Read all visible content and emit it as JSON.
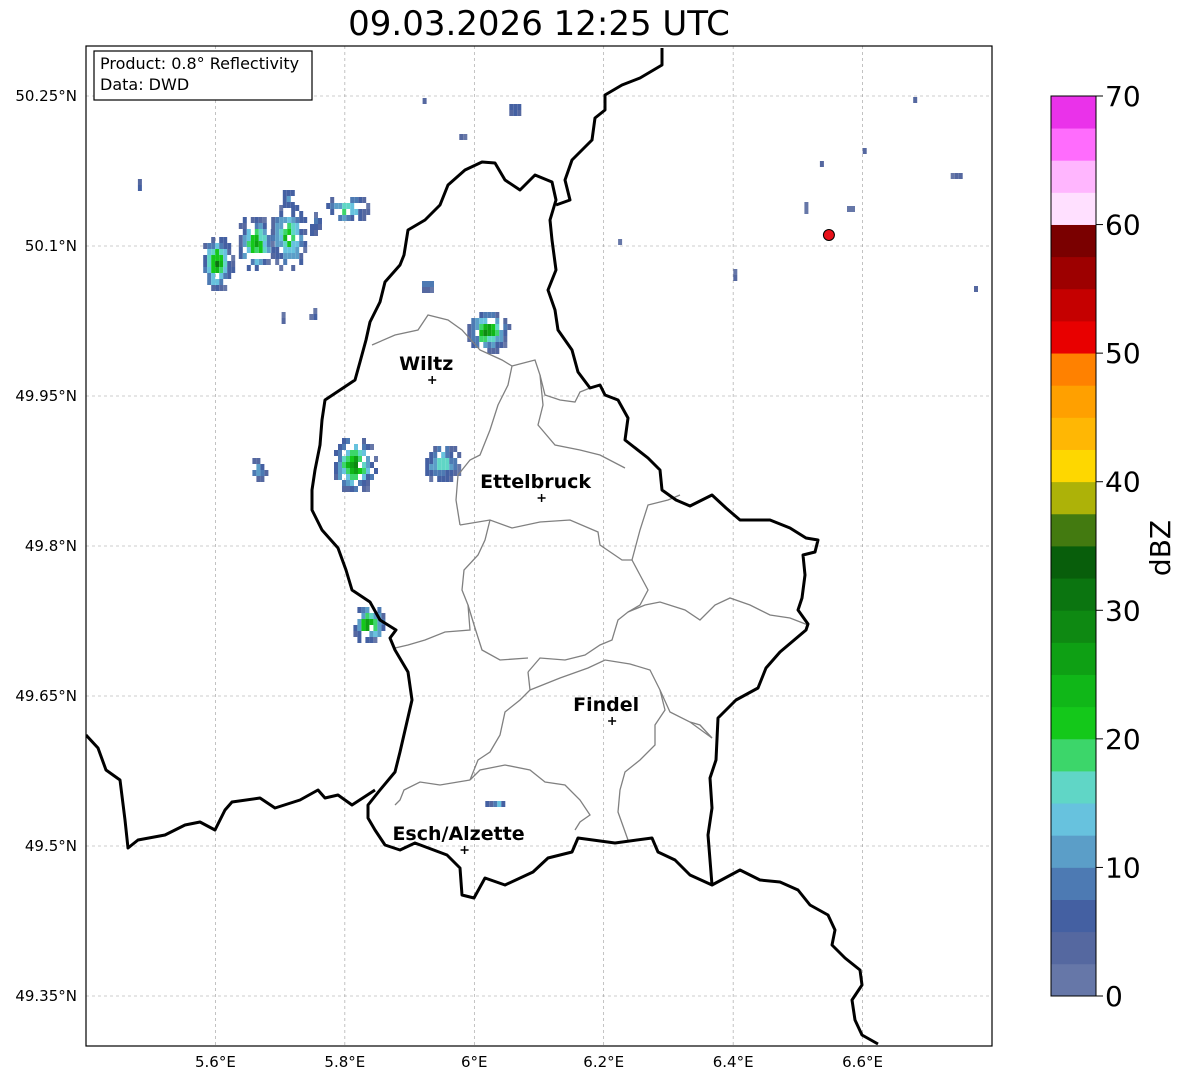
{
  "title": "09.03.2026 12:25 UTC",
  "info_box": {
    "product": "Product: 0.8° Reflectivity",
    "data": "Data: DWD"
  },
  "map": {
    "extent": {
      "lon": [
        5.4,
        6.8
      ],
      "lat": [
        49.3,
        50.3
      ]
    },
    "lat_ticks": [
      {
        "value": 50.25,
        "label": "50.25°N"
      },
      {
        "value": 50.1,
        "label": "50.1°N"
      },
      {
        "value": 49.95,
        "label": "49.95°N"
      },
      {
        "value": 49.8,
        "label": "49.8°N"
      },
      {
        "value": 49.65,
        "label": "49.65°N"
      },
      {
        "value": 49.5,
        "label": "49.5°N"
      },
      {
        "value": 49.35,
        "label": "49.35°N"
      }
    ],
    "lon_ticks": [
      {
        "value": 5.6,
        "label": "5.6°E"
      },
      {
        "value": 5.8,
        "label": "5.8°E"
      },
      {
        "value": 6.0,
        "label": "6°E"
      },
      {
        "value": 6.2,
        "label": "6.2°E"
      },
      {
        "value": 6.4,
        "label": "6.4°E"
      },
      {
        "value": 6.6,
        "label": "6.6°E"
      }
    ],
    "gridlines": true,
    "cities": [
      {
        "name": "Wiltz",
        "lon": 5.935,
        "lat": 49.966
      },
      {
        "name": "Ettelbruck",
        "lon": 6.104,
        "lat": 49.848
      },
      {
        "name": "Findel",
        "lon": 6.213,
        "lat": 49.625
      },
      {
        "name": "Esch/Alzette",
        "lon": 5.985,
        "lat": 49.496
      }
    ],
    "radar_site": {
      "lon": 6.548,
      "lat": 50.111,
      "color": "#e8101a"
    },
    "echoes": [
      {
        "lon": 5.6,
        "lat": 50.085,
        "rlon": 0.025,
        "rlat": 0.03,
        "max_dbz": 32
      },
      {
        "lon": 5.66,
        "lat": 50.105,
        "rlon": 0.03,
        "rlat": 0.03,
        "max_dbz": 28
      },
      {
        "lon": 5.71,
        "lat": 50.112,
        "rlon": 0.03,
        "rlat": 0.035,
        "max_dbz": 26
      },
      {
        "lon": 5.8,
        "lat": 50.14,
        "rlon": 0.035,
        "rlat": 0.015,
        "max_dbz": 22
      },
      {
        "lon": 5.71,
        "lat": 50.15,
        "rlon": 0.012,
        "rlat": 0.012,
        "max_dbz": 10
      },
      {
        "lon": 5.75,
        "lat": 50.125,
        "rlon": 0.01,
        "rlat": 0.015,
        "max_dbz": 8
      },
      {
        "lon": 5.48,
        "lat": 50.165,
        "rlon": 0.006,
        "rlat": 0.008,
        "max_dbz": 6
      },
      {
        "lon": 6.018,
        "lat": 50.018,
        "rlon": 0.035,
        "rlat": 0.022,
        "max_dbz": 32
      },
      {
        "lon": 5.925,
        "lat": 50.063,
        "rlon": 0.012,
        "rlat": 0.008,
        "max_dbz": 10
      },
      {
        "lon": 5.7,
        "lat": 50.03,
        "rlon": 0.004,
        "rlat": 0.01,
        "max_dbz": 6
      },
      {
        "lon": 5.75,
        "lat": 50.032,
        "rlon": 0.005,
        "rlat": 0.012,
        "max_dbz": 6
      },
      {
        "lon": 5.812,
        "lat": 49.884,
        "rlon": 0.035,
        "rlat": 0.03,
        "max_dbz": 33
      },
      {
        "lon": 5.948,
        "lat": 49.886,
        "rlon": 0.03,
        "rlat": 0.02,
        "max_dbz": 22
      },
      {
        "lon": 5.665,
        "lat": 49.88,
        "rlon": 0.014,
        "rlat": 0.014,
        "max_dbz": 14
      },
      {
        "lon": 5.835,
        "lat": 49.725,
        "rlon": 0.028,
        "rlat": 0.02,
        "max_dbz": 32
      },
      {
        "lon": 6.035,
        "lat": 49.545,
        "rlon": 0.018,
        "rlat": 0.006,
        "max_dbz": 14
      },
      {
        "lon": 6.06,
        "lat": 50.24,
        "rlon": 0.012,
        "rlat": 0.008,
        "max_dbz": 6
      },
      {
        "lon": 5.98,
        "lat": 50.212,
        "rlon": 0.003,
        "rlat": 0.006,
        "max_dbz": 4
      },
      {
        "lon": 5.92,
        "lat": 50.25,
        "rlon": 0.006,
        "rlat": 0.004,
        "max_dbz": 4
      },
      {
        "lon": 6.68,
        "lat": 50.25,
        "rlon": 0.008,
        "rlat": 0.005,
        "max_dbz": 4
      },
      {
        "lon": 6.74,
        "lat": 50.175,
        "rlon": 0.01,
        "rlat": 0.004,
        "max_dbz": 4
      },
      {
        "lon": 6.78,
        "lat": 50.125,
        "rlon": 0.004,
        "rlat": 0.004,
        "max_dbz": 4
      },
      {
        "lon": 6.54,
        "lat": 50.185,
        "rlon": 0.006,
        "rlat": 0.006,
        "max_dbz": 4
      },
      {
        "lon": 6.6,
        "lat": 50.2,
        "rlon": 0.006,
        "rlat": 0.004,
        "max_dbz": 4
      },
      {
        "lon": 6.4,
        "lat": 50.075,
        "rlon": 0.006,
        "rlat": 0.008,
        "max_dbz": 4
      },
      {
        "lon": 6.77,
        "lat": 50.062,
        "rlon": 0.004,
        "rlat": 0.004,
        "max_dbz": 4
      },
      {
        "lon": 6.22,
        "lat": 50.109,
        "rlon": 0.004,
        "rlat": 0.004,
        "max_dbz": 4
      },
      {
        "lon": 6.51,
        "lat": 50.14,
        "rlon": 0.006,
        "rlat": 0.01,
        "max_dbz": 4
      },
      {
        "lon": 6.58,
        "lat": 50.14,
        "rlon": 0.004,
        "rlat": 0.006,
        "max_dbz": 4
      }
    ]
  },
  "colorbar": {
    "label": "dBZ",
    "min": 0,
    "max": 70,
    "step": 2.5,
    "tick_values": [
      0,
      10,
      20,
      30,
      40,
      50,
      60,
      70
    ],
    "tick_labels": [
      "0",
      "10",
      "20",
      "30",
      "40",
      "50",
      "60",
      "70"
    ],
    "colors": [
      "#6677a8",
      "#5568a0",
      "#4460a2",
      "#4d7ab3",
      "#5b9ec8",
      "#67c2de",
      "#60d6c6",
      "#3cd66a",
      "#14c81a",
      "#10b718",
      "#0ea014",
      "#0e8912",
      "#0b7510",
      "#085e0b",
      "#437a10",
      "#adb208",
      "#fed700",
      "#ffb704",
      "#ffa000",
      "#ff8100",
      "#e80000",
      "#c50000",
      "#9d0000",
      "#7a0000",
      "#ffe0ff",
      "#ffb6fe",
      "#ff6cfd",
      "#ea32ea"
    ]
  }
}
